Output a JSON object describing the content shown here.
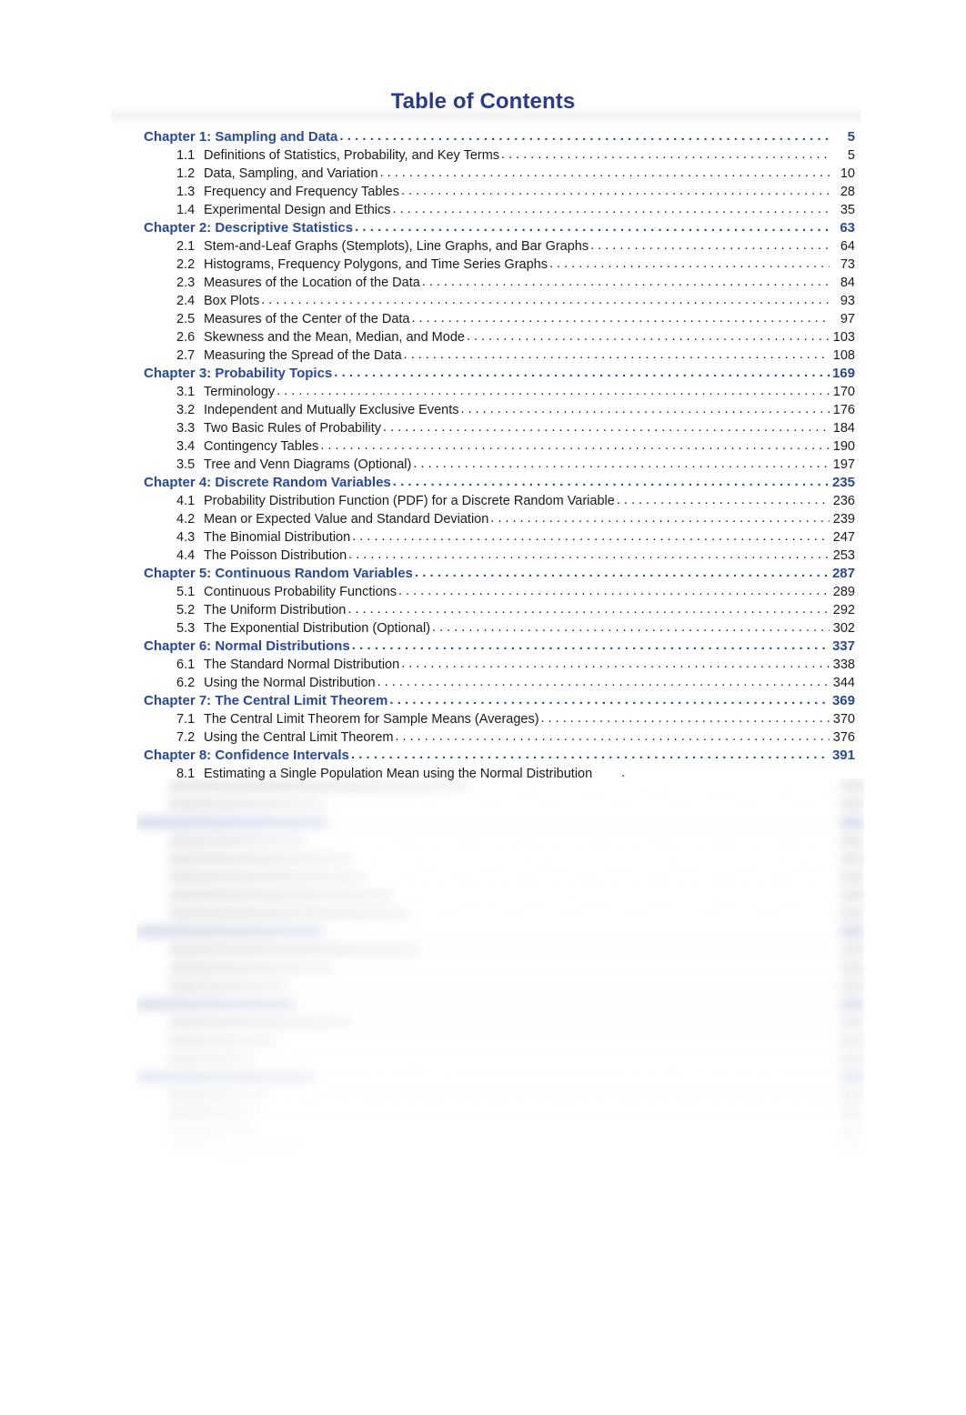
{
  "document": {
    "title": "Table of Contents"
  },
  "toc": {
    "entries": [
      {
        "level": "chapter",
        "label": "Chapter 1:  Sampling and Data",
        "page": "5"
      },
      {
        "level": "section",
        "number": "1.1",
        "label": "Definitions of Statistics, Probability, and Key Terms",
        "page": "5"
      },
      {
        "level": "section",
        "number": "1.2",
        "label": "Data, Sampling, and Variation",
        "page": "10"
      },
      {
        "level": "section",
        "number": "1.3",
        "label": "Frequency and Frequency Tables",
        "page": "28"
      },
      {
        "level": "section",
        "number": "1.4",
        "label": "Experimental Design and Ethics",
        "page": "35"
      },
      {
        "level": "chapter",
        "label": "Chapter 2:  Descriptive Statistics",
        "page": "63"
      },
      {
        "level": "section",
        "number": "2.1",
        "label": "Stem-and-Leaf Graphs (Stemplots), Line Graphs, and Bar Graphs",
        "page": "64"
      },
      {
        "level": "section",
        "number": "2.2",
        "label": "Histograms, Frequency Polygons, and Time Series Graphs",
        "page": "73"
      },
      {
        "level": "section",
        "number": "2.3",
        "label": "Measures of the Location of the Data",
        "page": "84"
      },
      {
        "level": "section",
        "number": "2.4",
        "label": "Box Plots",
        "page": "93"
      },
      {
        "level": "section",
        "number": "2.5",
        "label": "Measures of the Center of the Data",
        "page": "97"
      },
      {
        "level": "section",
        "number": "2.6",
        "label": "Skewness and the Mean, Median, and Mode",
        "page": "103"
      },
      {
        "level": "section",
        "number": "2.7",
        "label": "Measuring the Spread of the Data",
        "page": "108"
      },
      {
        "level": "chapter",
        "label": "Chapter 3:  Probability Topics",
        "page": "169"
      },
      {
        "level": "section",
        "number": "3.1",
        "label": "Terminology",
        "page": "170"
      },
      {
        "level": "section",
        "number": "3.2",
        "label": "Independent and Mutually Exclusive Events",
        "page": "176"
      },
      {
        "level": "section",
        "number": "3.3",
        "label": "Two Basic Rules of Probability",
        "page": "184"
      },
      {
        "level": "section",
        "number": "3.4",
        "label": "Contingency Tables",
        "page": "190"
      },
      {
        "level": "section",
        "number": "3.5",
        "label": "Tree and Venn Diagrams (Optional)",
        "page": "197"
      },
      {
        "level": "chapter",
        "label": "Chapter 4:  Discrete Random Variables",
        "page": "235"
      },
      {
        "level": "section",
        "number": "4.1",
        "label": "Probability Distribution Function (PDF) for a Discrete Random Variable",
        "page": "236"
      },
      {
        "level": "section",
        "number": "4.2",
        "label": "Mean or Expected Value and Standard Deviation",
        "page": "239"
      },
      {
        "level": "section",
        "number": "4.3",
        "label": "The Binomial Distribution",
        "page": "247"
      },
      {
        "level": "section",
        "number": "4.4",
        "label": "The Poisson Distribution",
        "page": "253"
      },
      {
        "level": "chapter",
        "label": "Chapter 5:  Continuous Random Variables",
        "page": "287"
      },
      {
        "level": "section",
        "number": "5.1",
        "label": "Continuous Probability Functions",
        "page": "289"
      },
      {
        "level": "section",
        "number": "5.2",
        "label": "The Uniform Distribution",
        "page": "292"
      },
      {
        "level": "section",
        "number": "5.3",
        "label": "The Exponential Distribution (Optional)",
        "page": "302"
      },
      {
        "level": "chapter",
        "label": "Chapter 6:  Normal Distributions",
        "page": "337"
      },
      {
        "level": "section",
        "number": "6.1",
        "label": "The Standard Normal Distribution",
        "page": "338"
      },
      {
        "level": "section",
        "number": "6.2",
        "label": "Using the Normal Distribution",
        "page": "344"
      },
      {
        "level": "chapter",
        "label": "Chapter 7:  The Central Limit Theorem",
        "page": "369"
      },
      {
        "level": "section",
        "number": "7.1",
        "label": "The Central Limit Theorem for Sample Means (Averages)",
        "page": "370"
      },
      {
        "level": "section",
        "number": "7.2",
        "label": "Using the Central Limit Theorem",
        "page": "376"
      },
      {
        "level": "chapter",
        "label": "Chapter 8:  Confidence Intervals",
        "page": "391"
      },
      {
        "level": "section",
        "number": "8.1",
        "label": "Estimating a Single Population Mean using the Normal Distribution",
        "page": "",
        "truncated": true
      }
    ],
    "obscured_note": "Remaining entries below are blurred and illegible in the source image."
  },
  "colors": {
    "title": "#2b3c84",
    "chapter": "#2b4a92",
    "section": "#1a1a1a",
    "page_background": "#ffffff"
  }
}
